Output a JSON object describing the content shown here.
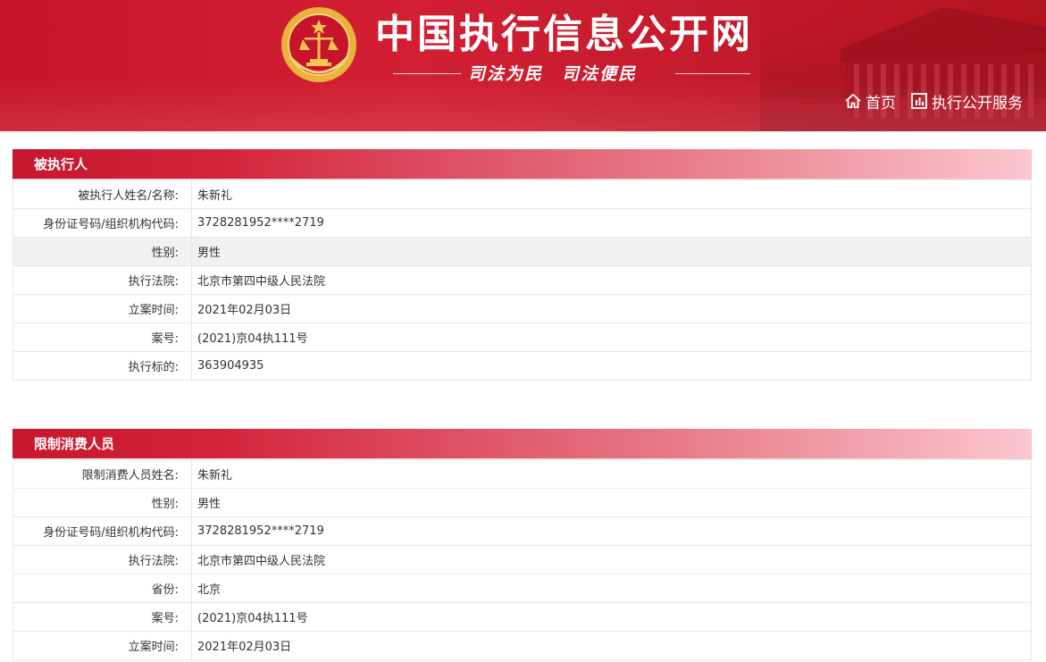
{
  "header": {
    "title": "中国执行信息公开网",
    "slogan": "司法为民　司法便民",
    "nav": [
      {
        "label": "首页",
        "icon": "home-icon"
      },
      {
        "label": "执行公开服务",
        "icon": "chart-icon"
      }
    ]
  },
  "colors": {
    "brand_red": "#c8142a",
    "section_gradient_end": "#fbc7cf",
    "gold": "#e8b33a"
  },
  "sections": [
    {
      "title": "被执行人",
      "rows": [
        {
          "label": "被执行人姓名/名称:",
          "value": "朱新礼"
        },
        {
          "label": "身份证号码/组织机构代码:",
          "value": "3728281952****2719"
        },
        {
          "label": "性别:",
          "value": "男性"
        },
        {
          "label": "执行法院:",
          "value": "北京市第四中级人民法院"
        },
        {
          "label": "立案时间:",
          "value": "2021年02月03日"
        },
        {
          "label": "案号:",
          "value": "(2021)京04执111号"
        },
        {
          "label": "执行标的:",
          "value": "363904935"
        }
      ]
    },
    {
      "title": "限制消费人员",
      "rows": [
        {
          "label": "限制消费人员姓名:",
          "value": "朱新礼"
        },
        {
          "label": "性别:",
          "value": "男性"
        },
        {
          "label": "身份证号码/组织机构代码:",
          "value": "3728281952****2719"
        },
        {
          "label": "执行法院:",
          "value": "北京市第四中级人民法院"
        },
        {
          "label": "省份:",
          "value": "北京"
        },
        {
          "label": "案号:",
          "value": "(2021)京04执111号"
        },
        {
          "label": "立案时间:",
          "value": "2021年02月03日"
        }
      ]
    }
  ]
}
